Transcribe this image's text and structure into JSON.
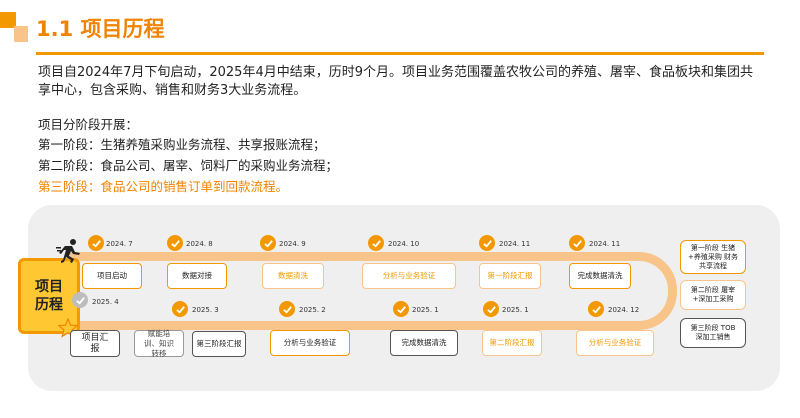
{
  "header": {
    "title": "1.1 项目历程"
  },
  "intro": {
    "line1": "项目自2024年7月下旬启动，2025年4月中结束，历时9个月。项目业务范围覆盖农牧公司的养殖、屠宰、食品板块和集团共",
    "line2": "享中心，包含采购、销售和财务3大业务流程。"
  },
  "phases": {
    "heading": "项目分阶段开展：",
    "p1": "第一阶段：生猪养殖采购业务流程、共享报账流程；",
    "p2": "第二阶段：食品公司、屠宰、饲料厂的采购业务流程；",
    "p3": "第三阶段：食品公司的销售订单到回款流程。"
  },
  "timeline": {
    "label": "项目历程",
    "top": [
      {
        "date": "2024. 7",
        "text": "项目启动"
      },
      {
        "date": "2024. 8",
        "text": "数据对接"
      },
      {
        "date": "2024. 9",
        "text": "数据清洗"
      },
      {
        "date": "2024. 10",
        "text": "分析与业务验证"
      },
      {
        "date": "2024. 11",
        "text": "第一阶段汇报"
      },
      {
        "date": "2024. 11",
        "text": "完成数据清洗"
      }
    ],
    "bottom": [
      {
        "date": "2025. 4",
        "text": "项目汇报"
      },
      {
        "date": "2025. 3",
        "text": "赋能培训、知识转移"
      },
      {
        "date": "",
        "text": "第三阶段汇报"
      },
      {
        "date": "2025. 2",
        "text": "分析与业务验证"
      },
      {
        "date": "2025. 1",
        "text": "完成数据清洗"
      },
      {
        "date": "2025. 1",
        "text": "第二阶段汇报"
      },
      {
        "date": "2024. 12",
        "text": "分析与业务验证"
      }
    ],
    "side": [
      {
        "text": "第一阶段 生猪+养殖采购 财务共享流程"
      },
      {
        "text": "第二阶段 屠宰+深加工采购"
      },
      {
        "text": "第三阶段 TOB深加工销售"
      }
    ]
  },
  "colors": {
    "accent": "#F39800",
    "accent_light": "#F9C48A",
    "label_bg": "#FFC832",
    "panel_bg": "#EFEFEF"
  },
  "icons": {
    "runner": "runner-icon",
    "star": "star-icon",
    "check": "check-icon"
  }
}
